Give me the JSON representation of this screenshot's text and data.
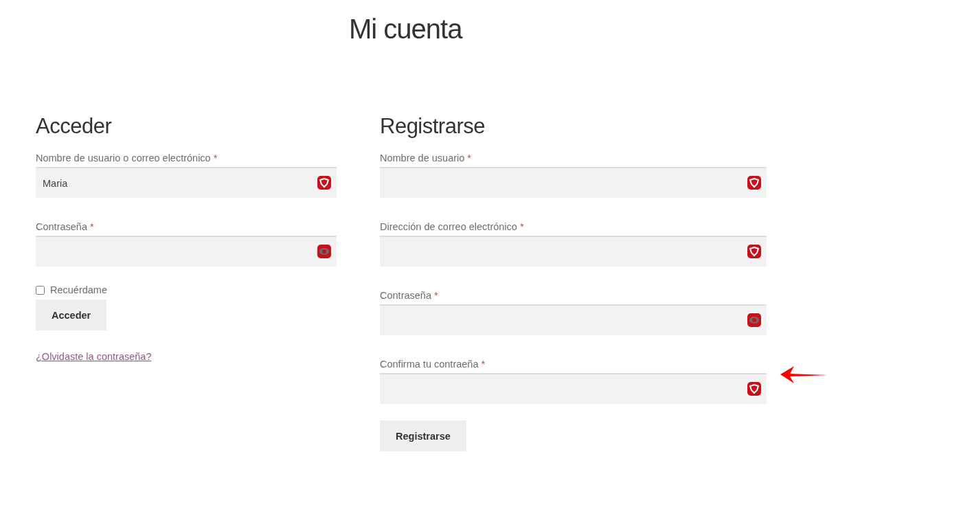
{
  "page": {
    "title": "Mi cuenta"
  },
  "login": {
    "heading": "Acceder",
    "fields": [
      {
        "label": "Nombre de usuario o correo electrónico",
        "required_mark": "*",
        "kind": "text",
        "value": "Maria"
      },
      {
        "label": "Contraseña",
        "required_mark": "*",
        "kind": "password"
      }
    ],
    "remember": {
      "label": "Recuérdame",
      "checked": false
    },
    "button": "Acceder",
    "forgot_link": "¿Olvidaste la contraseña?"
  },
  "register": {
    "heading": "Registrarse",
    "fields": [
      {
        "label": "Nombre de usuario",
        "required_mark": "*",
        "kind": "text"
      },
      {
        "label": "Dirección de correo electrónico",
        "required_mark": "*",
        "kind": "text"
      },
      {
        "label": "Contraseña",
        "required_mark": "*",
        "kind": "password"
      },
      {
        "label": "Confirma tu contraeña",
        "required_mark": "*",
        "kind": "text"
      }
    ],
    "button": "Registrarse"
  }
}
